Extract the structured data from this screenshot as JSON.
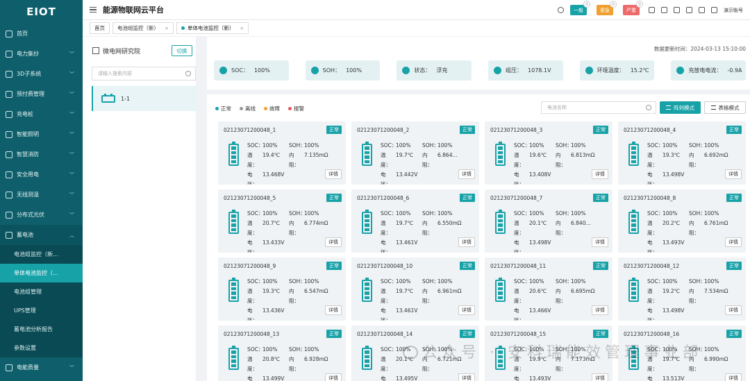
{
  "brand": "EIOT",
  "app_title": "能源物联网云平台",
  "header": {
    "alarms": [
      {
        "label": "一般",
        "count": "0",
        "color": "#17a2a8"
      },
      {
        "label": "紧急",
        "count": "0",
        "color": "#f0a030"
      },
      {
        "label": "严重",
        "count": "0",
        "color": "#ee6a6a"
      }
    ],
    "user": "演示账号"
  },
  "tabs": [
    {
      "label": "首页"
    },
    {
      "label": "电池组监控（新）"
    },
    {
      "label": "单体电池监控（新）"
    }
  ],
  "sidebar": {
    "items": [
      {
        "label": "首页",
        "has_children": false
      },
      {
        "label": "电力集抄",
        "has_children": true
      },
      {
        "label": "3D子系统",
        "has_children": true
      },
      {
        "label": "预付费管理",
        "has_children": true
      },
      {
        "label": "充电桩",
        "has_children": true
      },
      {
        "label": "智能照明",
        "has_children": true
      },
      {
        "label": "智慧消防",
        "has_children": true
      },
      {
        "label": "安全用电",
        "has_children": true
      },
      {
        "label": "无线测温",
        "has_children": true
      },
      {
        "label": "分布式光伏",
        "has_children": true
      },
      {
        "label": "蓄电池",
        "has_children": true,
        "open": true
      },
      {
        "label": "电池组监控（新...",
        "sub": true
      },
      {
        "label": "单体电池监控（...",
        "sub": true,
        "active": true
      },
      {
        "label": "电池组管理",
        "sub": true
      },
      {
        "label": "UPS管理",
        "sub": true
      },
      {
        "label": "蓄电池分析报告",
        "sub": true
      },
      {
        "label": "参数设置",
        "sub": true
      },
      {
        "label": "电能质量",
        "has_children": true
      }
    ]
  },
  "left_panel": {
    "title": "微电网研究院",
    "switch_label": "切换",
    "search_placeholder": "请输入搜索内容",
    "item_label": "1-1"
  },
  "main": {
    "updated_label": "数据更新时间：2024-03-13 15:10:00",
    "summary": [
      {
        "key": "SOC：",
        "value": "100%"
      },
      {
        "key": "SOH：",
        "value": "100%"
      },
      {
        "key": "状态：",
        "value": "浮充"
      },
      {
        "key": "组压：",
        "value": "1078.1V"
      },
      {
        "key": "环境温度：",
        "value": "15.2℃"
      },
      {
        "key": "充放电电流：",
        "value": "-0.9A"
      }
    ],
    "legend": [
      {
        "label": "正常",
        "color": "#17a2a8"
      },
      {
        "label": "离线",
        "color": "#999999"
      },
      {
        "label": "故障",
        "color": "#f0a030"
      },
      {
        "label": "报警",
        "color": "#ee5555"
      }
    ],
    "search_placeholder": "电池名称",
    "mode_active": "阵列模式",
    "mode_inactive": "表格模式",
    "labels": {
      "soc": "SOC：",
      "soh": "SOH：",
      "temp": "温度：",
      "res": "内阻：",
      "volt": "电压：",
      "detail": "详情"
    },
    "cells": [
      {
        "id": "02123071200048_1",
        "status": "正常",
        "soc": "100%",
        "soh": "100%",
        "temp": "19.4℃",
        "res": "7.135mΩ",
        "volt": "13.468V"
      },
      {
        "id": "02123071200048_2",
        "status": "正常",
        "soc": "100%",
        "soh": "100%",
        "temp": "19.7℃",
        "res": "6.864...",
        "volt": "13.442V"
      },
      {
        "id": "02123071200048_3",
        "status": "正常",
        "soc": "100%",
        "soh": "100%",
        "temp": "19.6℃",
        "res": "6.813mΩ",
        "volt": "13.408V"
      },
      {
        "id": "02123071200048_4",
        "status": "正常",
        "soc": "100%",
        "soh": "100%",
        "temp": "19.3℃",
        "res": "6.692mΩ",
        "volt": "13.498V"
      },
      {
        "id": "02123071200048_5",
        "status": "正常",
        "soc": "100%",
        "soh": "100%",
        "temp": "20.7℃",
        "res": "6.774mΩ",
        "volt": "13.433V"
      },
      {
        "id": "02123071200048_6",
        "status": "正常",
        "soc": "100%",
        "soh": "100%",
        "temp": "19.7℃",
        "res": "6.550mΩ",
        "volt": "13.461V"
      },
      {
        "id": "02123071200048_7",
        "status": "正常",
        "soc": "100%",
        "soh": "100%",
        "temp": "20.1℃",
        "res": "6.840...",
        "volt": "13.498V"
      },
      {
        "id": "02123071200048_8",
        "status": "正常",
        "soc": "100%",
        "soh": "100%",
        "temp": "20.2℃",
        "res": "6.761mΩ",
        "volt": "13.493V"
      },
      {
        "id": "02123071200048_9",
        "status": "正常",
        "soc": "100%",
        "soh": "100%",
        "temp": "19.3℃",
        "res": "6.547mΩ",
        "volt": "13.436V"
      },
      {
        "id": "02123071200048_10",
        "status": "正常",
        "soc": "100%",
        "soh": "100%",
        "temp": "19.7℃",
        "res": "6.961mΩ",
        "volt": "13.461V"
      },
      {
        "id": "02123071200048_11",
        "status": "正常",
        "soc": "100%",
        "soh": "100%",
        "temp": "20.6℃",
        "res": "6.695mΩ",
        "volt": "13.466V"
      },
      {
        "id": "02123071200048_12",
        "status": "正常",
        "soc": "100%",
        "soh": "100%",
        "temp": "19.2℃",
        "res": "7.534mΩ",
        "volt": "13.498V"
      },
      {
        "id": "02123071200048_13",
        "status": "正常",
        "soc": "100%",
        "soh": "100%",
        "temp": "20.8℃",
        "res": "6.928mΩ",
        "volt": "13.499V"
      },
      {
        "id": "02123071200048_14",
        "status": "正常",
        "soc": "100%",
        "soh": "100%",
        "temp": "20.1℃",
        "res": "6.721mΩ",
        "volt": "13.495V"
      },
      {
        "id": "02123071200048_15",
        "status": "正常",
        "soc": "100%",
        "soh": "100%",
        "temp": "19.9℃",
        "res": "7.173mΩ",
        "volt": "13.493V"
      },
      {
        "id": "02123071200048_16",
        "status": "正常",
        "soc": "100%",
        "soh": "100%",
        "temp": "19.7℃",
        "res": "6.990mΩ",
        "volt": "13.513V"
      }
    ]
  },
  "watermark": "公众号 · 安科瑞能效管理事业部"
}
